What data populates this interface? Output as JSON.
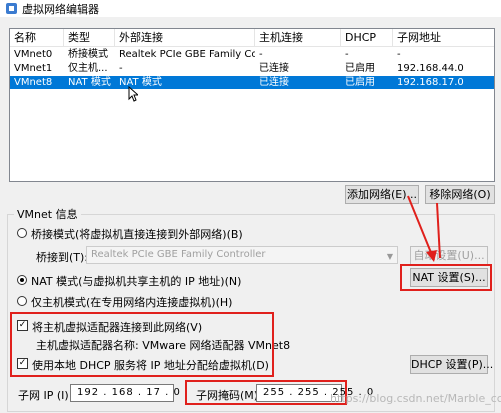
{
  "window": {
    "title": "虚拟网络编辑器"
  },
  "table": {
    "columns": [
      "名称",
      "类型",
      "外部连接",
      "主机连接",
      "DHCP",
      "子网地址"
    ],
    "rows": [
      [
        "VMnet0",
        "桥接模式",
        "Realtek PCIe GBE Family Co...",
        "-",
        "-",
        "-"
      ],
      [
        "VMnet1",
        "仅主机...",
        "-",
        "已连接",
        "已启用",
        "192.168.44.0"
      ],
      [
        "VMnet8",
        "NAT 模式",
        "NAT 模式",
        "已连接",
        "已启用",
        "192.168.17.0"
      ]
    ],
    "selected_row": 2
  },
  "buttons": {
    "add_network": "添加网络(E)...",
    "remove_network": "移除网络(O)",
    "auto_settings": "自动设置(U)...",
    "nat_settings": "NAT 设置(S)...",
    "dhcp_settings": "DHCP 设置(P)..."
  },
  "vmnet_info": {
    "group_title": "VMnet 信息",
    "bridge_mode": "桥接模式(将虚拟机直接连接到外部网络)(B)",
    "bridge_to_label": "桥接到(T):",
    "bridge_to_value": "Realtek PCIe GBE Family Controller",
    "nat_mode": "NAT 模式(与虚拟机共享主机的 IP 地址)(N)",
    "host_only_mode": "仅主机模式(在专用网络内连接虚拟机)(H)",
    "selected_mode": "nat",
    "connect_adapter": "将主机虚拟适配器连接到此网络(V)",
    "adapter_name": "主机虚拟适配器名称: VMware 网络适配器 VMnet8",
    "use_dhcp": "使用本地 DHCP 服务将 IP 地址分配给虚拟机(D)",
    "subnet_ip_label": "子网 IP (I):",
    "subnet_ip": "192 . 168 . 17 . 0",
    "subnet_mask_label": "子网掩码(M):",
    "subnet_mask": "255 . 255 . 255 . 0"
  },
  "watermark": "https://blog.csdn.net/Marble_ccp",
  "colors": {
    "selection": "#0078d7",
    "annotation": "#e0201c"
  }
}
